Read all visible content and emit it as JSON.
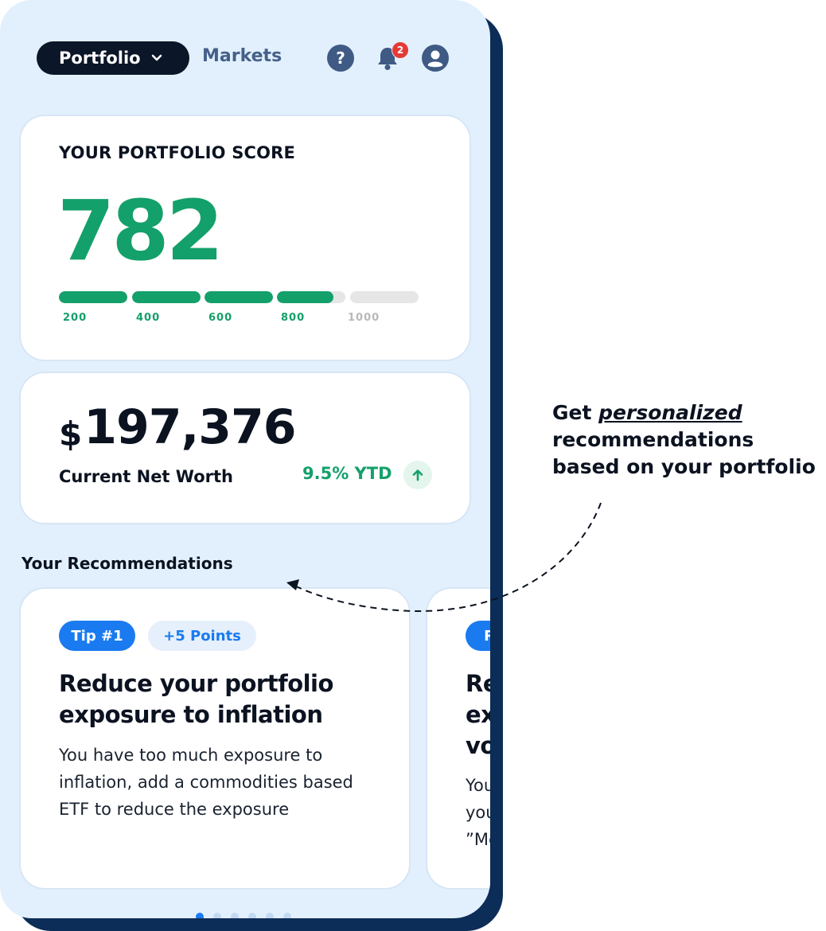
{
  "header": {
    "active_tab": "Portfolio",
    "other_tab": "Markets",
    "notification_count": "2",
    "help_glyph": "?"
  },
  "score_card": {
    "title": "YOUR PORTFOLIO SCORE",
    "score": "782",
    "score_value": 782,
    "scale_ticks": [
      "200",
      "400",
      "600",
      "800",
      "1000"
    ]
  },
  "net_worth": {
    "currency": "$",
    "amount": "197,376",
    "label": "Current Net Worth",
    "ytd": "9.5% YTD"
  },
  "recommendations": {
    "heading": "Your Recommendations",
    "cards": [
      {
        "tip": "Tip #1",
        "points": "+5 Points",
        "title": "Reduce your portfolio exposure to inflation",
        "body": "You have too much exposure to inflation, add a commodities based ETF to reduce the exposure"
      },
      {
        "tip": "R",
        "title_lines": [
          "Re",
          "ex",
          "vo"
        ],
        "body_lines": [
          "You",
          "you",
          "”Mc"
        ]
      }
    ],
    "pager_count": 6,
    "pager_active": 0
  },
  "callout": {
    "prefix": "Get ",
    "emphasis": "personalized",
    "line2": "recommendations",
    "line3": "based on your portfolio"
  },
  "colors": {
    "brand_green": "#14a06a",
    "brand_blue": "#1a7bf0",
    "dark_navy": "#0b1628",
    "phone_bg": "#e2f0fd"
  }
}
